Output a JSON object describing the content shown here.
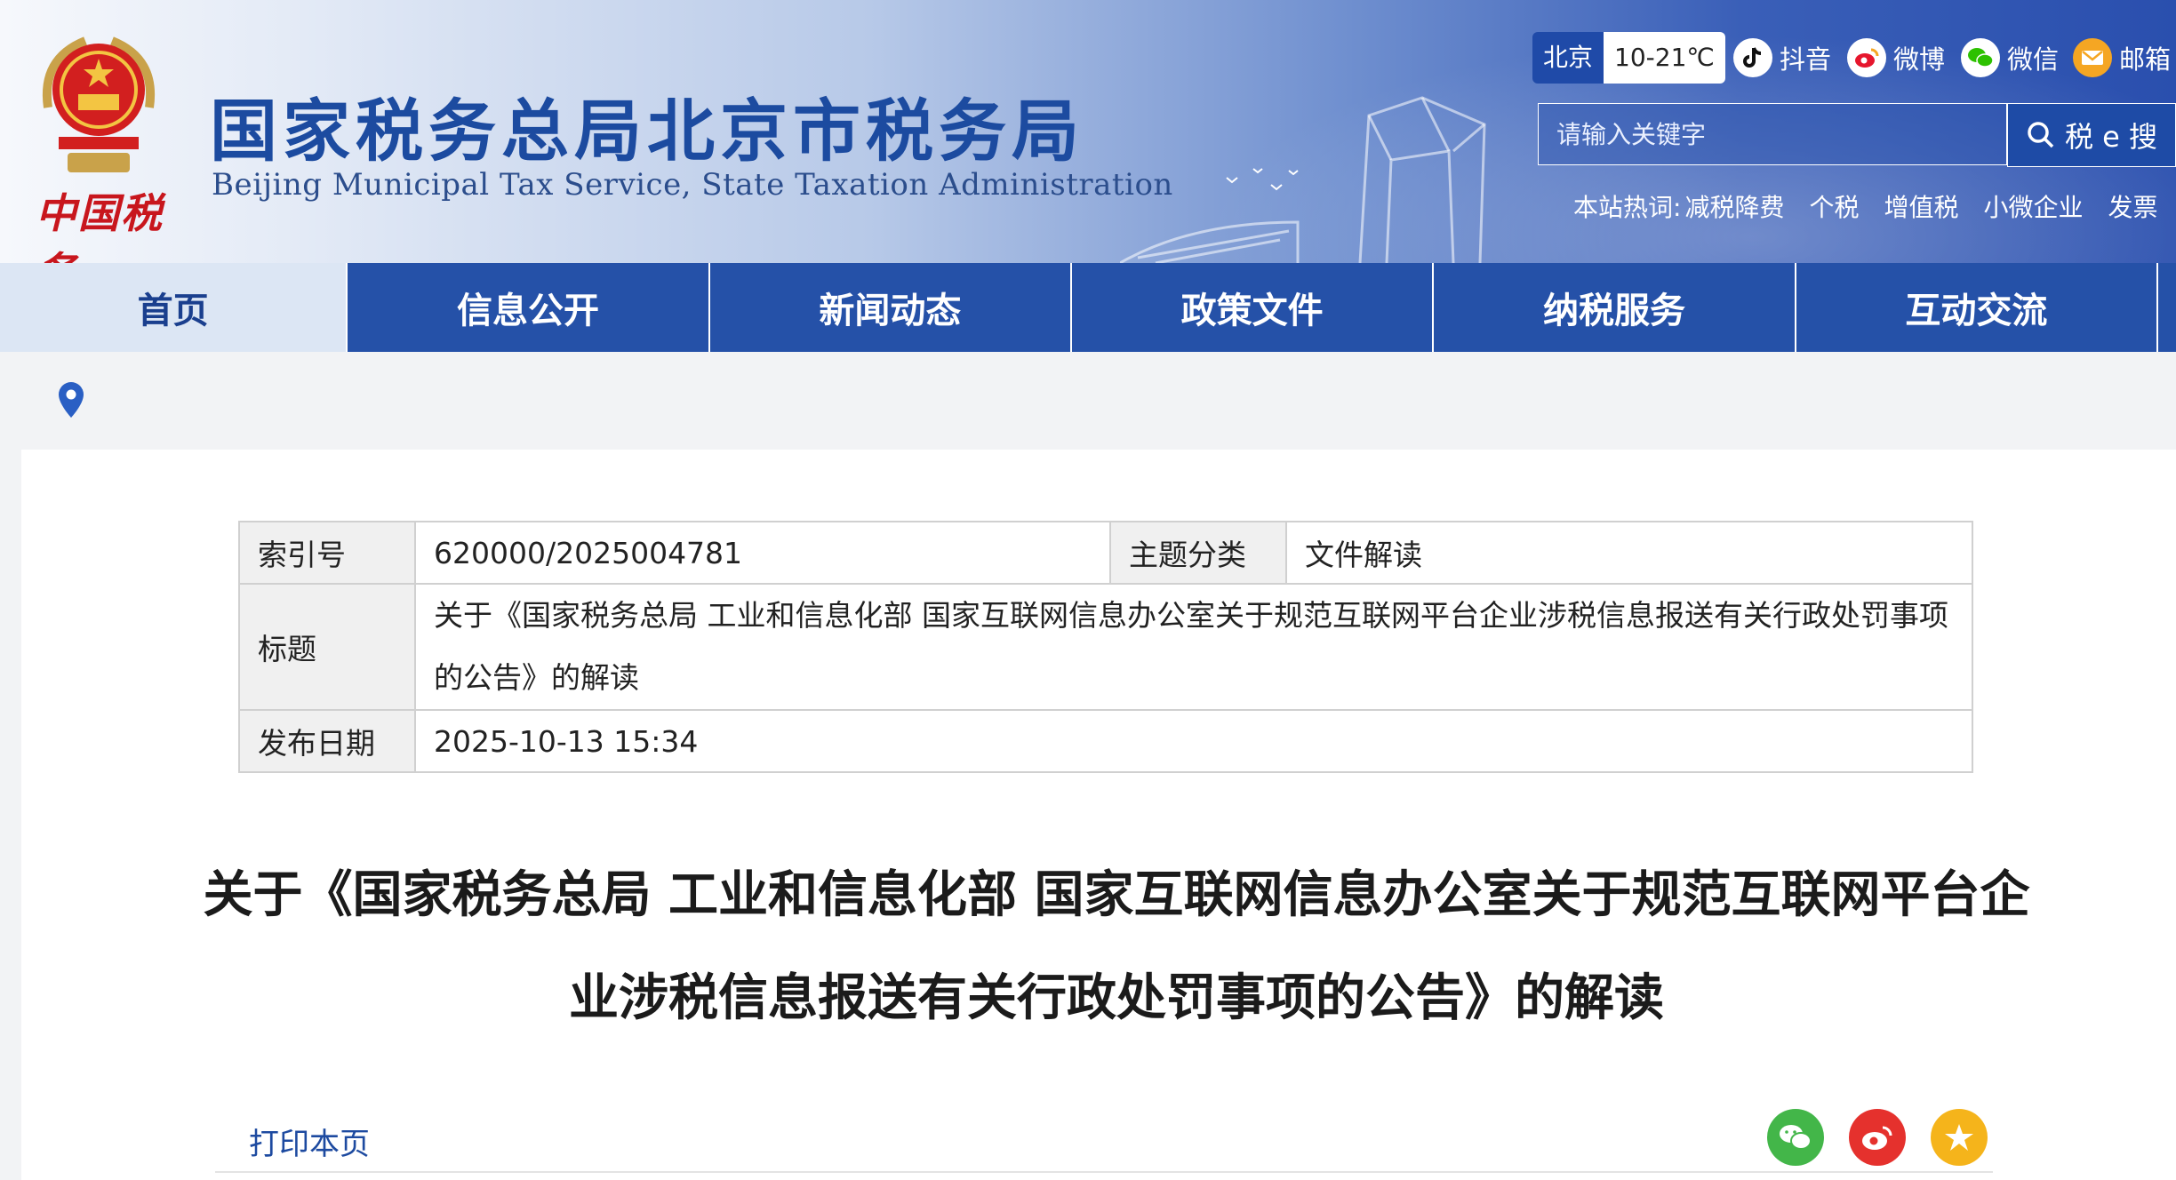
{
  "header": {
    "logo_text": "中国税务",
    "site_title": "国家税务总局北京市税务局",
    "site_subtitle": "Beijing Municipal Tax Service, State Taxation Administration",
    "weather": {
      "city": "北京",
      "temp": "10-21℃"
    },
    "social": [
      {
        "label": "抖音",
        "icon": "douyin-icon",
        "color": "#111111"
      },
      {
        "label": "微博",
        "icon": "weibo-icon",
        "color": "#e6162d"
      },
      {
        "label": "微信",
        "icon": "wechat-icon",
        "color": "#2dc100"
      },
      {
        "label": "邮箱",
        "icon": "mail-icon",
        "color": "#f5a623"
      }
    ],
    "search": {
      "placeholder": "请输入关键字",
      "button_label": "税 e 搜"
    },
    "hotwords": {
      "label": "本站热词:",
      "items": [
        "减税降费",
        "个税",
        "增值税",
        "小微企业",
        "发票"
      ]
    }
  },
  "nav": {
    "items": [
      "首页",
      "信息公开",
      "新闻动态",
      "政策文件",
      "纳税服务",
      "互动交流"
    ],
    "active": "首页"
  },
  "meta_table": {
    "index_label": "索引号",
    "index_value": "620000/2025004781",
    "topic_label": "主题分类",
    "topic_value": "文件解读",
    "title_label": "标题",
    "title_value": "关于《国家税务总局 工业和信息化部 国家互联网信息办公室关于规范互联网平台企业涉税信息报送有关行政处罚事项的公告》的解读",
    "date_label": "发布日期",
    "date_value": "2025-10-13 15:34"
  },
  "article": {
    "title": "关于《国家税务总局 工业和信息化部 国家互联网信息办公室关于规范互联网平台企业涉税信息报送有关行政处罚事项的公告》的解读",
    "print_label": "打印本页"
  },
  "share": [
    {
      "icon": "wechat-share-icon",
      "color": "#43b649"
    },
    {
      "icon": "weibo-share-icon",
      "color": "#e5312d"
    },
    {
      "icon": "qzone-share-icon",
      "color": "#f5b41b"
    }
  ]
}
